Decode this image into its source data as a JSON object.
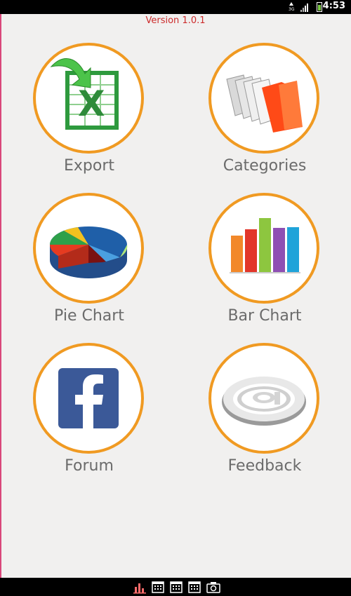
{
  "status_bar": {
    "time": "4:53",
    "network": "3G"
  },
  "app": {
    "version": "Version 1.0.1"
  },
  "menu": [
    {
      "label": "Export",
      "icon": "excel-icon"
    },
    {
      "label": "Categories",
      "icon": "folders-icon"
    },
    {
      "label": "Pie Chart",
      "icon": "pie-chart-icon"
    },
    {
      "label": "Bar Chart",
      "icon": "bar-chart-icon"
    },
    {
      "label": "Forum",
      "icon": "facebook-icon"
    },
    {
      "label": "Feedback",
      "icon": "at-sign-icon"
    }
  ],
  "colors": {
    "accent_ring": "#f09a22",
    "version_text": "#cc2b2b",
    "label_text": "#6b6b6b",
    "background": "#f1f0ef"
  }
}
